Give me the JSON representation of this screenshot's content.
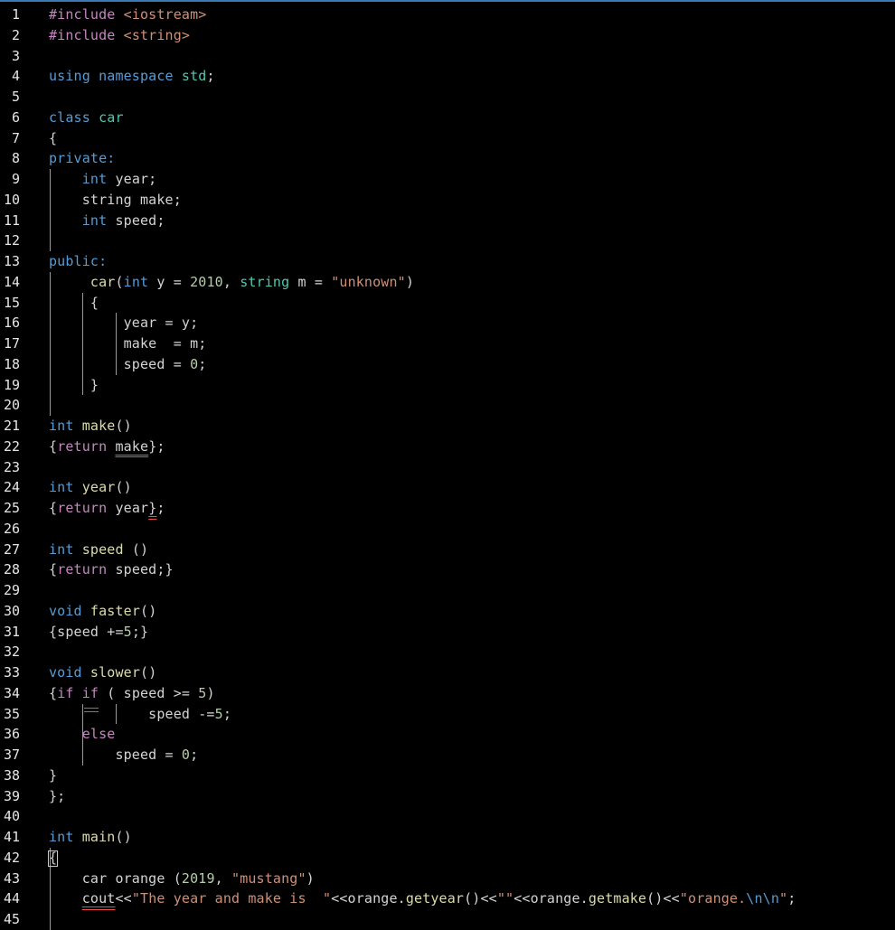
{
  "editor": {
    "lines": [
      {
        "n": "1",
        "tokens": [
          {
            "t": "#include ",
            "c": "pre"
          },
          {
            "t": "<iostream>",
            "c": "inc"
          }
        ]
      },
      {
        "n": "2",
        "tokens": [
          {
            "t": "#include ",
            "c": "pre"
          },
          {
            "t": "<string>",
            "c": "inc"
          }
        ]
      },
      {
        "n": "3",
        "tokens": []
      },
      {
        "n": "4",
        "tokens": [
          {
            "t": "using namespace ",
            "c": "kw"
          },
          {
            "t": "std",
            "c": "ty"
          },
          {
            "t": ";",
            "c": ""
          }
        ]
      },
      {
        "n": "5",
        "tokens": []
      },
      {
        "n": "6",
        "tokens": [
          {
            "t": "class ",
            "c": "kw"
          },
          {
            "t": "car",
            "c": "ty"
          }
        ]
      },
      {
        "n": "7",
        "tokens": [
          {
            "t": "{",
            "c": ""
          }
        ]
      },
      {
        "n": "8",
        "tokens": [
          {
            "t": "private:",
            "c": "kw"
          }
        ]
      },
      {
        "n": "9",
        "tokens": [
          {
            "t": "    ",
            "c": ""
          },
          {
            "t": "int",
            "c": "kw"
          },
          {
            "t": " year;",
            "c": ""
          }
        ]
      },
      {
        "n": "10",
        "tokens": [
          {
            "t": "    string make;",
            "c": ""
          }
        ]
      },
      {
        "n": "11",
        "tokens": [
          {
            "t": "    ",
            "c": ""
          },
          {
            "t": "int",
            "c": "kw"
          },
          {
            "t": " speed;",
            "c": ""
          }
        ]
      },
      {
        "n": "12",
        "tokens": []
      },
      {
        "n": "13",
        "tokens": [
          {
            "t": "public:",
            "c": "kw"
          }
        ]
      },
      {
        "n": "14",
        "tokens": [
          {
            "t": "     ",
            "c": ""
          },
          {
            "t": "car",
            "c": "fn"
          },
          {
            "t": "(",
            "c": ""
          },
          {
            "t": "int",
            "c": "kw"
          },
          {
            "t": " y = ",
            "c": ""
          },
          {
            "t": "2010",
            "c": "num"
          },
          {
            "t": ", ",
            "c": ""
          },
          {
            "t": "string",
            "c": "ty"
          },
          {
            "t": " m = ",
            "c": ""
          },
          {
            "t": "\"unknown\"",
            "c": "str"
          },
          {
            "t": ")",
            "c": ""
          }
        ]
      },
      {
        "n": "15",
        "tokens": [
          {
            "t": "     {",
            "c": ""
          }
        ]
      },
      {
        "n": "16",
        "tokens": [
          {
            "t": "         year = y;",
            "c": ""
          }
        ]
      },
      {
        "n": "17",
        "tokens": [
          {
            "t": "         make  = m;",
            "c": ""
          }
        ]
      },
      {
        "n": "18",
        "tokens": [
          {
            "t": "         speed = ",
            "c": ""
          },
          {
            "t": "0",
            "c": "num"
          },
          {
            "t": ";",
            "c": ""
          }
        ]
      },
      {
        "n": "19",
        "tokens": [
          {
            "t": "     }",
            "c": ""
          }
        ]
      },
      {
        "n": "20",
        "tokens": []
      },
      {
        "n": "21",
        "tokens": [
          {
            "t": "int",
            "c": "kw"
          },
          {
            "t": " ",
            "c": ""
          },
          {
            "t": "make",
            "c": "fn"
          },
          {
            "t": "()",
            "c": ""
          }
        ]
      },
      {
        "n": "22",
        "tokens": [
          {
            "t": "{",
            "c": ""
          },
          {
            "t": "return",
            "c": "ctl"
          },
          {
            "t": " ",
            "c": ""
          },
          {
            "t": "make",
            "c": "err"
          },
          {
            "t": "};",
            "c": ""
          }
        ]
      },
      {
        "n": "23",
        "tokens": []
      },
      {
        "n": "24",
        "tokens": [
          {
            "t": "int",
            "c": "kw"
          },
          {
            "t": " ",
            "c": ""
          },
          {
            "t": "year",
            "c": "fn"
          },
          {
            "t": "()",
            "c": ""
          }
        ]
      },
      {
        "n": "25",
        "tokens": [
          {
            "t": "{",
            "c": ""
          },
          {
            "t": "return",
            "c": "ctl"
          },
          {
            "t": " year",
            "c": ""
          },
          {
            "t": "}",
            "c": "err"
          },
          {
            "t": ";",
            "c": ""
          }
        ]
      },
      {
        "n": "26",
        "tokens": []
      },
      {
        "n": "27",
        "tokens": [
          {
            "t": "int",
            "c": "kw"
          },
          {
            "t": " ",
            "c": ""
          },
          {
            "t": "speed",
            "c": "fn"
          },
          {
            "t": " ()",
            "c": ""
          }
        ]
      },
      {
        "n": "28",
        "tokens": [
          {
            "t": "{",
            "c": ""
          },
          {
            "t": "return",
            "c": "ctl"
          },
          {
            "t": " speed;}",
            "c": ""
          }
        ]
      },
      {
        "n": "29",
        "tokens": []
      },
      {
        "n": "30",
        "tokens": [
          {
            "t": "void",
            "c": "kw"
          },
          {
            "t": " ",
            "c": ""
          },
          {
            "t": "faster",
            "c": "fn"
          },
          {
            "t": "()",
            "c": ""
          }
        ]
      },
      {
        "n": "31",
        "tokens": [
          {
            "t": "{speed +=",
            "c": ""
          },
          {
            "t": "5",
            "c": "num"
          },
          {
            "t": ";}",
            "c": ""
          }
        ]
      },
      {
        "n": "32",
        "tokens": []
      },
      {
        "n": "33",
        "tokens": [
          {
            "t": "void",
            "c": "kw"
          },
          {
            "t": " ",
            "c": ""
          },
          {
            "t": "slower",
            "c": "fn"
          },
          {
            "t": "()",
            "c": ""
          }
        ]
      },
      {
        "n": "34",
        "tokens": [
          {
            "t": "{",
            "c": ""
          },
          {
            "t": "if",
            "c": "ctl"
          },
          {
            "t": " ",
            "c": ""
          },
          {
            "t": "if",
            "c": "ctl"
          },
          {
            "t": " ( speed >= ",
            "c": ""
          },
          {
            "t": "5",
            "c": "num"
          },
          {
            "t": ")",
            "c": ""
          }
        ]
      },
      {
        "n": "35",
        "tokens": [
          {
            "t": "            speed -=",
            "c": ""
          },
          {
            "t": "5",
            "c": "num"
          },
          {
            "t": ";",
            "c": ""
          }
        ]
      },
      {
        "n": "36",
        "tokens": [
          {
            "t": "    ",
            "c": ""
          },
          {
            "t": "else",
            "c": "ctl"
          }
        ]
      },
      {
        "n": "37",
        "tokens": [
          {
            "t": "        speed = ",
            "c": ""
          },
          {
            "t": "0",
            "c": "num"
          },
          {
            "t": ";",
            "c": ""
          }
        ]
      },
      {
        "n": "38",
        "tokens": [
          {
            "t": "}",
            "c": ""
          }
        ]
      },
      {
        "n": "39",
        "tokens": [
          {
            "t": "};",
            "c": ""
          }
        ]
      },
      {
        "n": "40",
        "tokens": []
      },
      {
        "n": "41",
        "tokens": [
          {
            "t": "int",
            "c": "kw"
          },
          {
            "t": " ",
            "c": ""
          },
          {
            "t": "main",
            "c": "fn"
          },
          {
            "t": "()",
            "c": ""
          }
        ]
      },
      {
        "n": "42",
        "tokens": [
          {
            "t": "{",
            "c": ""
          }
        ]
      },
      {
        "n": "43",
        "tokens": [
          {
            "t": "    car orange (",
            "c": ""
          },
          {
            "t": "2019",
            "c": "num"
          },
          {
            "t": ", ",
            "c": ""
          },
          {
            "t": "\"mustang\"",
            "c": "str"
          },
          {
            "t": ")",
            "c": ""
          }
        ]
      },
      {
        "n": "44",
        "tokens": [
          {
            "t": "    ",
            "c": ""
          },
          {
            "t": "cout",
            "c": "err"
          },
          {
            "t": "<<",
            "c": ""
          },
          {
            "t": "\"The year and make is  \"",
            "c": "str"
          },
          {
            "t": "<<orange.",
            "c": ""
          },
          {
            "t": "getyear",
            "c": "fn"
          },
          {
            "t": "()<<",
            "c": ""
          },
          {
            "t": "\"\"",
            "c": "str"
          },
          {
            "t": "<<orange.",
            "c": ""
          },
          {
            "t": "getmake",
            "c": "fn"
          },
          {
            "t": "()<<",
            "c": ""
          },
          {
            "t": "\"orange.",
            "c": "str"
          },
          {
            "t": "\\n\\n",
            "c": "esc"
          },
          {
            "t": "\"",
            "c": "str"
          },
          {
            "t": ";",
            "c": ""
          }
        ]
      },
      {
        "n": "45",
        "tokens": []
      }
    ]
  },
  "colors": {
    "background": "#000000",
    "keyword": "#569cd6",
    "type": "#4ec9b0",
    "function": "#dcdcaa",
    "string": "#ce9178",
    "number": "#b5cea8",
    "control": "#c586c0",
    "error_underline": "#f14c4c"
  }
}
